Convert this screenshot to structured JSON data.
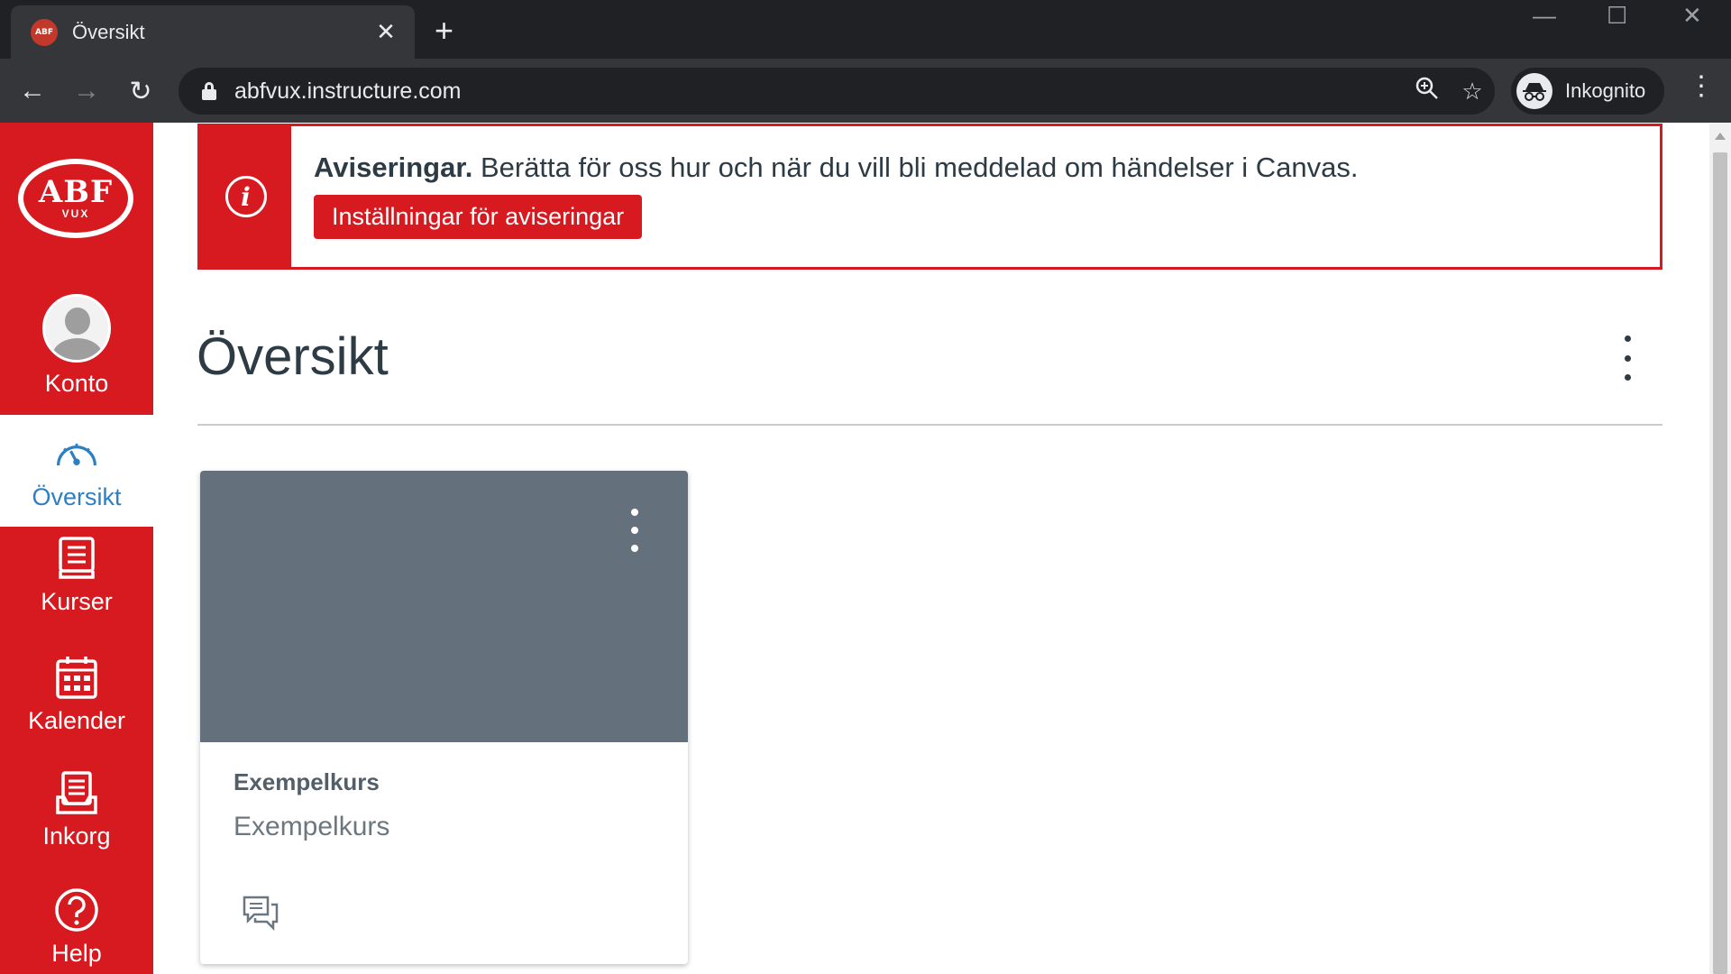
{
  "browser": {
    "tab_title": "Översikt",
    "url": "abfvux.instructure.com",
    "profile_label": "Inkognito"
  },
  "logo": {
    "main": "ABF",
    "sub": "VUX"
  },
  "gnav": {
    "account": "Konto",
    "dashboard": "Översikt",
    "courses": "Kurser",
    "calendar": "Kalender",
    "inbox": "Inkorg",
    "help": "Help",
    "active_color": "#2d7fc4",
    "brand_color": "#d71920"
  },
  "alert": {
    "heading": "Aviseringar.",
    "message": "Berätta för oss hur och när du vill bli meddelad om händelser i Canvas.",
    "button_label": "Inställningar för aviseringar"
  },
  "main": {
    "title": "Översikt"
  },
  "course_card": {
    "name": "Exempelkurs",
    "subtitle": "Exempelkurs",
    "hero_color": "#64717d"
  }
}
